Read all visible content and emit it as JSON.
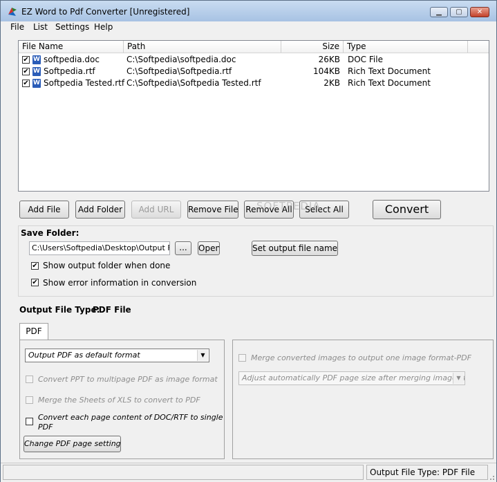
{
  "window": {
    "title": "EZ Word to Pdf Converter [Unregistered]"
  },
  "menu": [
    "File",
    "List",
    "Settings",
    "Help"
  ],
  "file_list": {
    "columns": [
      "File Name",
      "Path",
      "Size",
      "Type"
    ],
    "rows": [
      {
        "name": "softpedia.doc",
        "path": "C:\\Softpedia\\softpedia.doc",
        "size": "26KB",
        "type": "DOC File",
        "checked": true
      },
      {
        "name": "Softpedia.rtf",
        "path": "C:\\Softpedia\\Softpedia.rtf",
        "size": "104KB",
        "type": "Rich Text Document",
        "checked": true
      },
      {
        "name": "Softpedia Tested.rtf",
        "path": "C:\\Softpedia\\Softpedia Tested.rtf",
        "size": "2KB",
        "type": "Rich Text Document",
        "checked": true
      }
    ]
  },
  "toolbar": {
    "add_file": "Add File",
    "add_folder": "Add Folder",
    "add_url": "Add URL",
    "remove_file": "Remove File",
    "remove_all": "Remove All",
    "select_all": "Select All",
    "convert": "Convert"
  },
  "save_folder": {
    "label": "Save Folder:",
    "path": "C:\\Users\\Softpedia\\Desktop\\Output Files",
    "browse": "...",
    "open": "Open",
    "set_name": "Set output file name",
    "show_output": "Show output folder when done",
    "show_error": "Show error information in conversion"
  },
  "output_type": {
    "label": "Output File Type:",
    "value": "PDF File"
  },
  "tabs": [
    "PDF"
  ],
  "pdf_options": {
    "format_select": "Output PDF as default format",
    "ppt_multipage": "Convert PPT to multipage PDF as image format",
    "merge_xls": "Merge the Sheets of XLS to convert to PDF",
    "each_page_line1": "Convert each page content of DOC/RTF to single",
    "each_page_line2": "PDF",
    "change_settings": "Change PDF page settings",
    "merge_images": "Merge converted images to output one image format-PDF",
    "adjust_select": "Adjust automatically PDF page size after merging images to Pl"
  },
  "status": {
    "text": "Output File Type:  PDF File"
  },
  "watermark": "SOFTPEDIA",
  "colors": {
    "accent": "#a9c5e6",
    "word_icon": "#2a5cb8"
  }
}
